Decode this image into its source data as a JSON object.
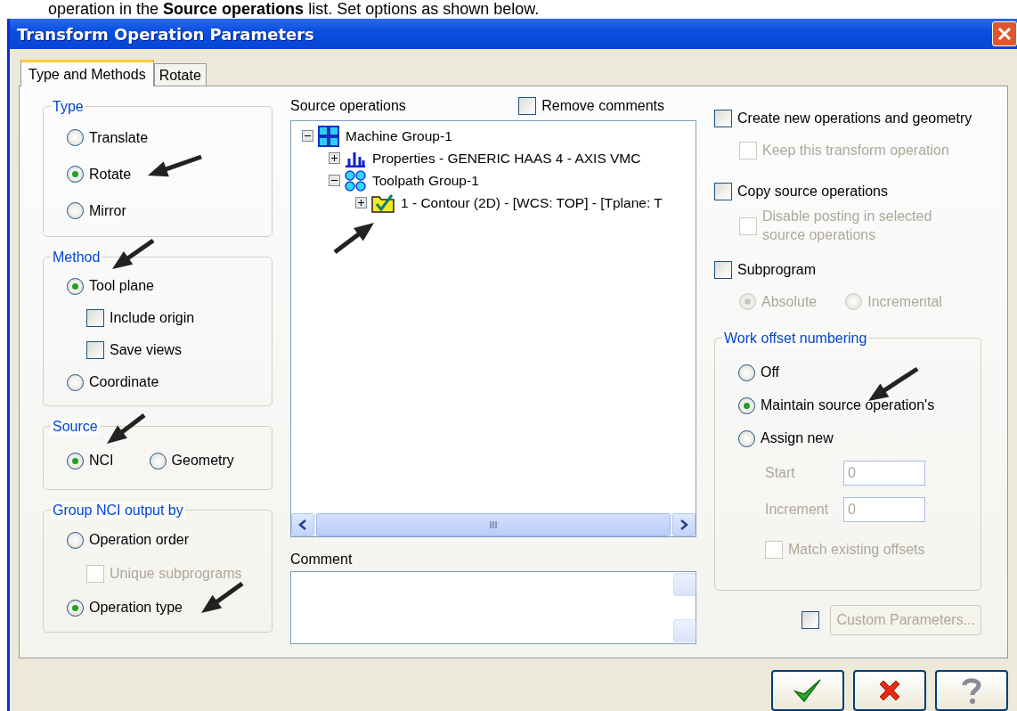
{
  "caption": "operation in the **Source operations** list. Set options as shown below.",
  "window": {
    "title": "Transform Operation Parameters"
  },
  "tabs": [
    {
      "label": "Type and Methods",
      "selected": true
    },
    {
      "label": "Rotate",
      "selected": false
    }
  ],
  "left_groups": [
    {
      "title": "Type",
      "options": [
        {
          "kind": "radio",
          "label": "Translate",
          "selected": false,
          "disabled": false
        },
        {
          "kind": "radio",
          "label": "Rotate",
          "selected": true,
          "disabled": false
        },
        {
          "kind": "radio",
          "label": "Mirror",
          "selected": false,
          "disabled": false
        }
      ]
    },
    {
      "title": "Method",
      "options": [
        {
          "kind": "radio",
          "label": "Tool plane",
          "selected": true,
          "disabled": false,
          "children": [
            {
              "kind": "checkbox",
              "label": "Include origin",
              "checked": false,
              "disabled": false
            },
            {
              "kind": "checkbox",
              "label": "Save views",
              "checked": false,
              "disabled": false
            }
          ]
        },
        {
          "kind": "radio",
          "label": "Coordinate",
          "selected": false,
          "disabled": false
        }
      ]
    },
    {
      "title": "Source",
      "options": [
        {
          "kind": "radio_row",
          "options": [
            {
              "kind": "radio",
              "label": "NCI",
              "selected": true,
              "disabled": false
            },
            {
              "kind": "radio",
              "label": "Geometry",
              "selected": false,
              "disabled": false
            }
          ]
        }
      ]
    },
    {
      "title": "Group NCI output by",
      "options": [
        {
          "kind": "radio",
          "label": "Operation order",
          "selected": false,
          "disabled": false,
          "children": [
            {
              "kind": "checkbox",
              "label": "Unique subprograms",
              "checked": false,
              "disabled": true
            }
          ]
        },
        {
          "kind": "radio",
          "label": "Operation type",
          "selected": true,
          "disabled": false
        }
      ]
    }
  ],
  "source_operations": {
    "label": "Source operations",
    "remove_comments": {
      "label": "Remove comments",
      "checked": false
    },
    "tree": [
      {
        "kind": "machine",
        "label": "Machine Group-1",
        "expanded": true,
        "children": [
          {
            "kind": "properties",
            "label": "Properties - GENERIC HAAS 4 - AXIS VMC",
            "expanded": false
          },
          {
            "kind": "toolpath",
            "label": "Toolpath Group-1",
            "expanded": true,
            "children": [
              {
                "kind": "operation",
                "label": "1 - Contour (2D) - [WCS: TOP] - [Tplane: T",
                "expanded": false
              }
            ]
          }
        ]
      }
    ],
    "scroll_grip": "III"
  },
  "comment": {
    "label": "Comment"
  },
  "right_options": [
    {
      "kind": "checkbox",
      "label": "Create new operations and geometry",
      "checked": false,
      "disabled": false,
      "children": [
        {
          "kind": "checkbox",
          "label": "Keep this transform operation",
          "checked": false,
          "disabled": true
        }
      ]
    },
    {
      "kind": "checkbox",
      "label": "Copy source operations",
      "checked": false,
      "disabled": false,
      "children": [
        {
          "kind": "checkbox",
          "label": "Disable posting in selected source operations",
          "checked": false,
          "disabled": true
        }
      ]
    },
    {
      "kind": "checkbox",
      "label": "Subprogram",
      "checked": false,
      "disabled": false,
      "children": [
        {
          "kind": "radio_row",
          "options": [
            {
              "kind": "radio",
              "label": "Absolute",
              "selected": true,
              "disabled": true
            },
            {
              "kind": "radio",
              "label": "Incremental",
              "selected": false,
              "disabled": true
            }
          ]
        }
      ]
    }
  ],
  "work_offset": {
    "title": "Work offset numbering",
    "options": [
      {
        "kind": "radio",
        "label": "Off",
        "selected": false,
        "disabled": false
      },
      {
        "kind": "radio",
        "label": "Maintain source operation's",
        "selected": true,
        "disabled": false
      },
      {
        "kind": "radio",
        "label": "Assign new",
        "selected": false,
        "disabled": false
      },
      {
        "kind": "field",
        "label": "Start",
        "value": "0",
        "disabled": true
      },
      {
        "kind": "field",
        "label": "Increment",
        "value": "0",
        "disabled": true
      },
      {
        "kind": "checkbox",
        "label": "Match existing offsets",
        "checked": false,
        "disabled": true
      }
    ]
  },
  "custom": {
    "checked": false,
    "button": {
      "label": "Custom Parameters...",
      "disabled": true
    }
  },
  "buttons": [
    {
      "kind": "ok"
    },
    {
      "kind": "cancel"
    },
    {
      "kind": "help"
    }
  ]
}
